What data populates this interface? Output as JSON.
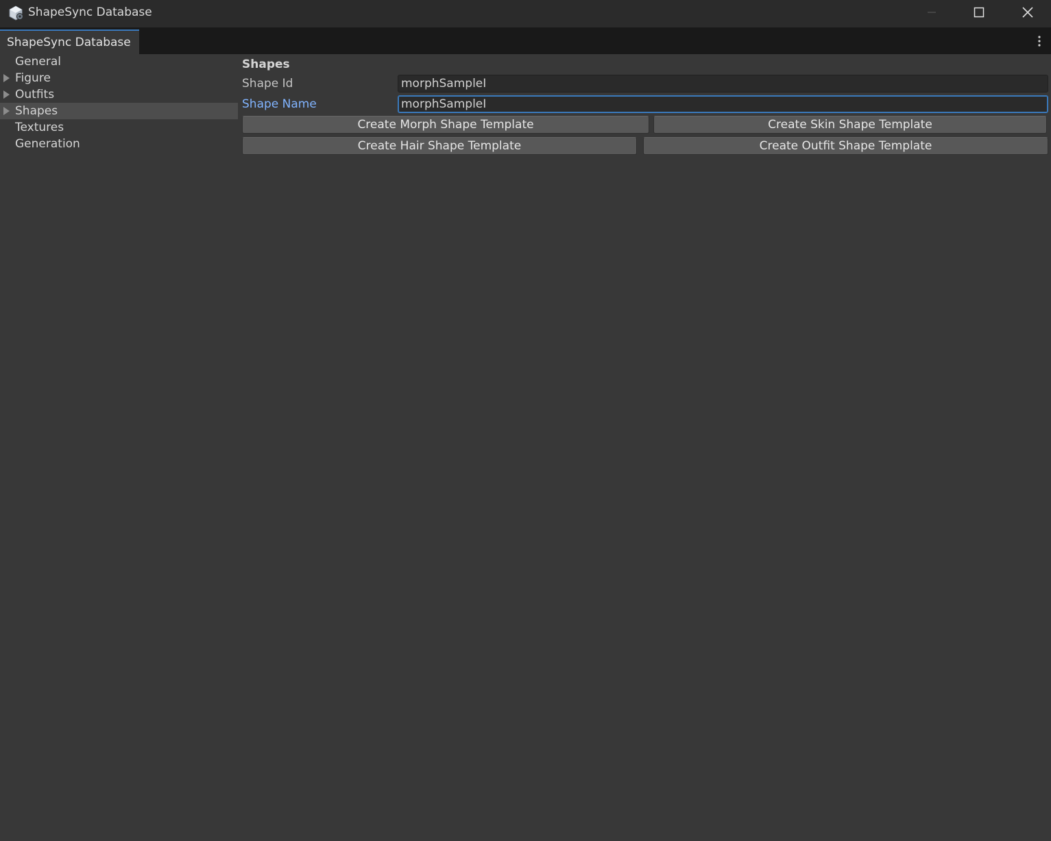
{
  "window": {
    "title": "ShapeSync Database",
    "icon": "unity-cube-icon"
  },
  "tab": {
    "label": "ShapeSync Database",
    "menu_icon": "kebab-menu-icon"
  },
  "sidebar": {
    "items": [
      {
        "label": "General",
        "expandable": false,
        "selected": false
      },
      {
        "label": "Figure",
        "expandable": true,
        "selected": false
      },
      {
        "label": "Outfits",
        "expandable": true,
        "selected": false
      },
      {
        "label": "Shapes",
        "expandable": true,
        "selected": true
      },
      {
        "label": "Textures",
        "expandable": false,
        "selected": false
      },
      {
        "label": "Generation",
        "expandable": false,
        "selected": false
      }
    ]
  },
  "main": {
    "section_title": "Shapes",
    "fields": {
      "shape_id": {
        "label": "Shape Id",
        "value": "morphSampleI"
      },
      "shape_name": {
        "label": "Shape Name",
        "value": "morphSampleI",
        "focused": true
      }
    },
    "buttons": {
      "morph": "Create Morph Shape Template",
      "skin": "Create Skin Shape Template",
      "hair": "Create Hair Shape Template",
      "outfit": "Create Outfit Shape Template"
    }
  },
  "colors": {
    "accent": "#3a79bb",
    "focused_label": "#81b4ff",
    "background": "#383838"
  }
}
